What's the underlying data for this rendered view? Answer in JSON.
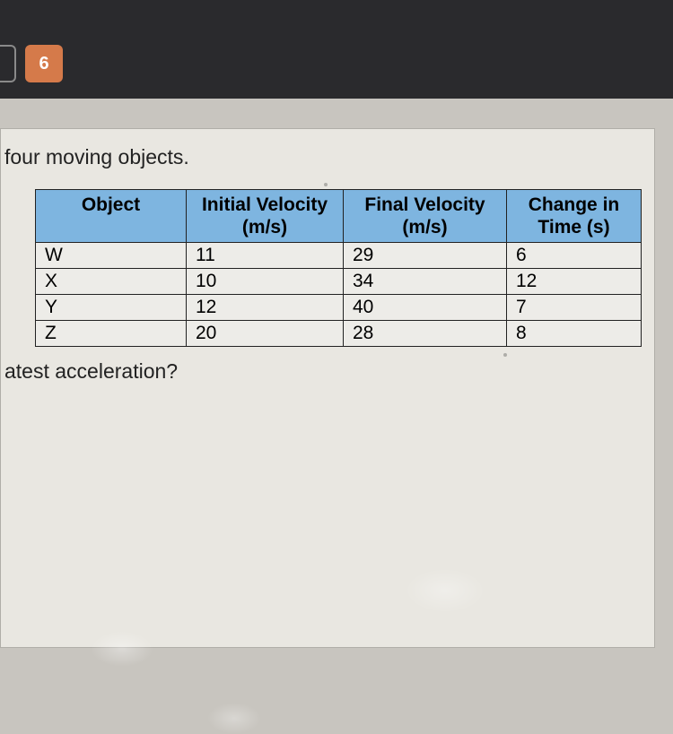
{
  "nav": {
    "current": "6"
  },
  "prompt_fragment_top": "four moving objects.",
  "prompt_fragment_bottom": "atest acceleration?",
  "table": {
    "headers": {
      "object": "Object",
      "initial_velocity_line1": "Initial Velocity",
      "initial_velocity_line2": "(m/s)",
      "final_velocity_line1": "Final Velocity",
      "final_velocity_line2": "(m/s)",
      "change_time_line1": "Change in",
      "change_time_line2": "Time (s)"
    },
    "rows": [
      {
        "object": "W",
        "initial_velocity": "11",
        "final_velocity": "29",
        "change_time": "6"
      },
      {
        "object": "X",
        "initial_velocity": "10",
        "final_velocity": "34",
        "change_time": "12"
      },
      {
        "object": "Y",
        "initial_velocity": "12",
        "final_velocity": "40",
        "change_time": "7"
      },
      {
        "object": "Z",
        "initial_velocity": "20",
        "final_velocity": "28",
        "change_time": "8"
      }
    ]
  },
  "chart_data": {
    "type": "table",
    "title": "four moving objects",
    "columns": [
      "Object",
      "Initial Velocity (m/s)",
      "Final Velocity (m/s)",
      "Change in Time (s)"
    ],
    "rows": [
      [
        "W",
        11,
        29,
        6
      ],
      [
        "X",
        10,
        34,
        12
      ],
      [
        "Y",
        12,
        40,
        7
      ],
      [
        "Z",
        20,
        28,
        8
      ]
    ]
  }
}
